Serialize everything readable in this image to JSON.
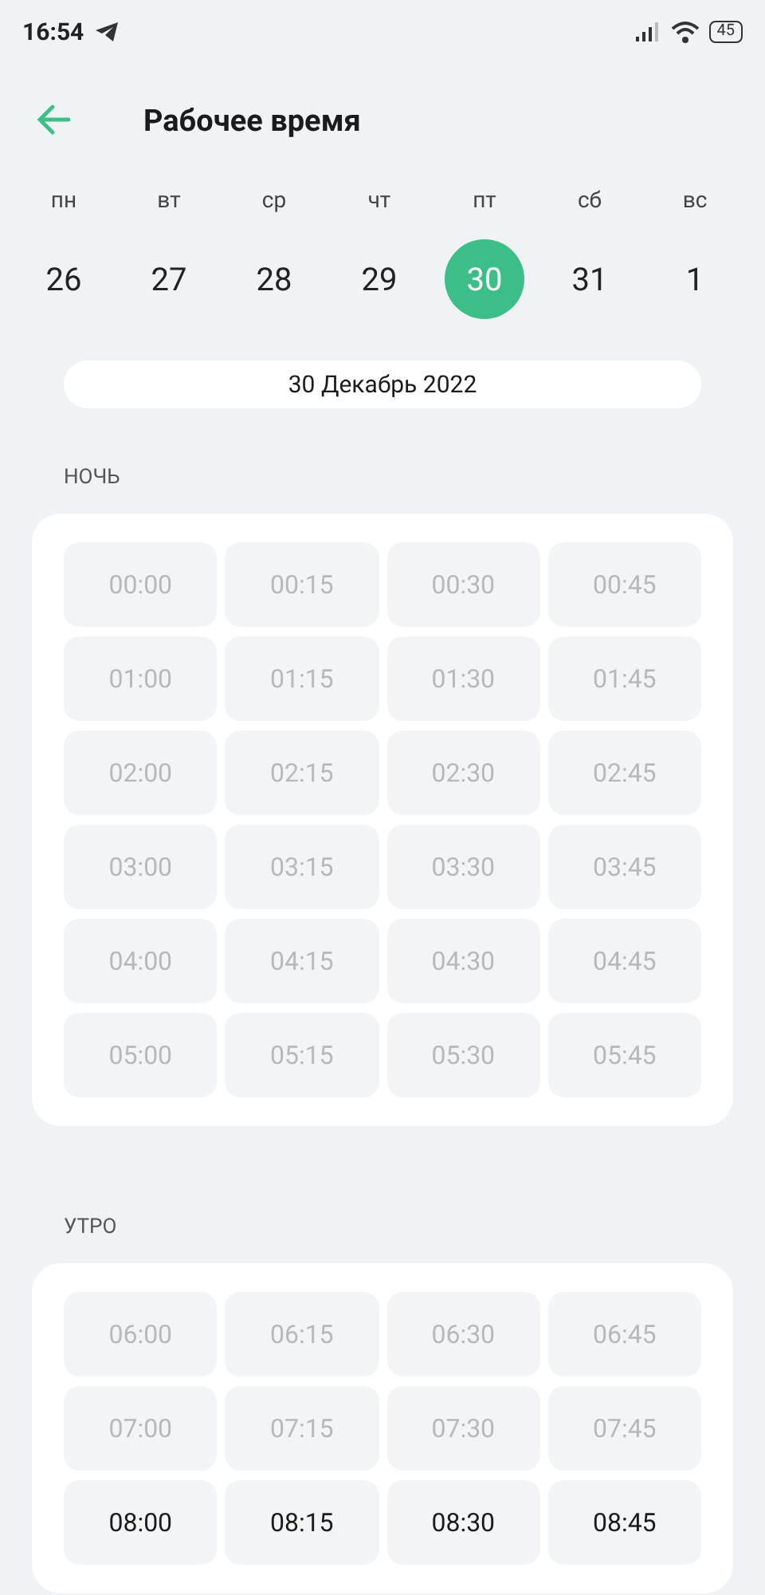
{
  "status_bar": {
    "time": "16:54",
    "battery": "45"
  },
  "header": {
    "title": "Рабочее время"
  },
  "week": [
    {
      "weekday": "пн",
      "day": "26",
      "selected": false
    },
    {
      "weekday": "вт",
      "day": "27",
      "selected": false
    },
    {
      "weekday": "ср",
      "day": "28",
      "selected": false
    },
    {
      "weekday": "чт",
      "day": "29",
      "selected": false
    },
    {
      "weekday": "пт",
      "day": "30",
      "selected": true
    },
    {
      "weekday": "сб",
      "day": "31",
      "selected": false
    },
    {
      "weekday": "вс",
      "day": "1",
      "selected": false
    }
  ],
  "date_label": "30 Декабрь 2022",
  "sections": [
    {
      "title": "НОЧЬ",
      "slots": [
        {
          "time": "00:00",
          "disabled": true
        },
        {
          "time": "00:15",
          "disabled": true
        },
        {
          "time": "00:30",
          "disabled": true
        },
        {
          "time": "00:45",
          "disabled": true
        },
        {
          "time": "01:00",
          "disabled": true
        },
        {
          "time": "01:15",
          "disabled": true
        },
        {
          "time": "01:30",
          "disabled": true
        },
        {
          "time": "01:45",
          "disabled": true
        },
        {
          "time": "02:00",
          "disabled": true
        },
        {
          "time": "02:15",
          "disabled": true
        },
        {
          "time": "02:30",
          "disabled": true
        },
        {
          "time": "02:45",
          "disabled": true
        },
        {
          "time": "03:00",
          "disabled": true
        },
        {
          "time": "03:15",
          "disabled": true
        },
        {
          "time": "03:30",
          "disabled": true
        },
        {
          "time": "03:45",
          "disabled": true
        },
        {
          "time": "04:00",
          "disabled": true
        },
        {
          "time": "04:15",
          "disabled": true
        },
        {
          "time": "04:30",
          "disabled": true
        },
        {
          "time": "04:45",
          "disabled": true
        },
        {
          "time": "05:00",
          "disabled": true
        },
        {
          "time": "05:15",
          "disabled": true
        },
        {
          "time": "05:30",
          "disabled": true
        },
        {
          "time": "05:45",
          "disabled": true
        }
      ]
    },
    {
      "title": "УТРО",
      "slots": [
        {
          "time": "06:00",
          "disabled": true
        },
        {
          "time": "06:15",
          "disabled": true
        },
        {
          "time": "06:30",
          "disabled": true
        },
        {
          "time": "06:45",
          "disabled": true
        },
        {
          "time": "07:00",
          "disabled": true
        },
        {
          "time": "07:15",
          "disabled": true
        },
        {
          "time": "07:30",
          "disabled": true
        },
        {
          "time": "07:45",
          "disabled": true
        },
        {
          "time": "08:00",
          "disabled": false
        },
        {
          "time": "08:15",
          "disabled": false
        },
        {
          "time": "08:30",
          "disabled": false
        },
        {
          "time": "08:45",
          "disabled": false
        }
      ]
    }
  ]
}
